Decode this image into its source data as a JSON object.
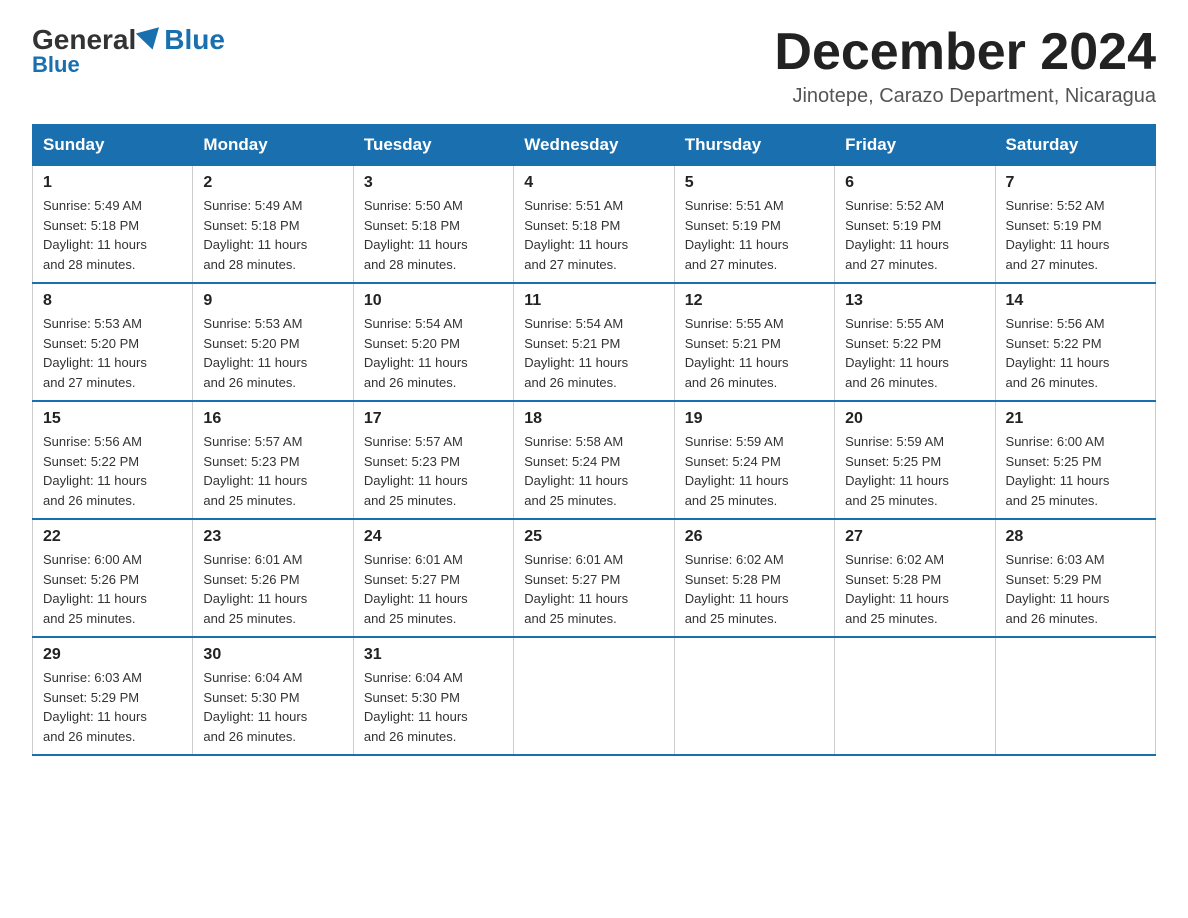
{
  "header": {
    "logo_general": "General",
    "logo_blue": "Blue",
    "month_title": "December 2024",
    "location": "Jinotepe, Carazo Department, Nicaragua"
  },
  "days_of_week": [
    "Sunday",
    "Monday",
    "Tuesday",
    "Wednesday",
    "Thursday",
    "Friday",
    "Saturday"
  ],
  "weeks": [
    [
      {
        "day": "1",
        "sunrise": "5:49 AM",
        "sunset": "5:18 PM",
        "daylight": "11 hours and 28 minutes."
      },
      {
        "day": "2",
        "sunrise": "5:49 AM",
        "sunset": "5:18 PM",
        "daylight": "11 hours and 28 minutes."
      },
      {
        "day": "3",
        "sunrise": "5:50 AM",
        "sunset": "5:18 PM",
        "daylight": "11 hours and 28 minutes."
      },
      {
        "day": "4",
        "sunrise": "5:51 AM",
        "sunset": "5:18 PM",
        "daylight": "11 hours and 27 minutes."
      },
      {
        "day": "5",
        "sunrise": "5:51 AM",
        "sunset": "5:19 PM",
        "daylight": "11 hours and 27 minutes."
      },
      {
        "day": "6",
        "sunrise": "5:52 AM",
        "sunset": "5:19 PM",
        "daylight": "11 hours and 27 minutes."
      },
      {
        "day": "7",
        "sunrise": "5:52 AM",
        "sunset": "5:19 PM",
        "daylight": "11 hours and 27 minutes."
      }
    ],
    [
      {
        "day": "8",
        "sunrise": "5:53 AM",
        "sunset": "5:20 PM",
        "daylight": "11 hours and 27 minutes."
      },
      {
        "day": "9",
        "sunrise": "5:53 AM",
        "sunset": "5:20 PM",
        "daylight": "11 hours and 26 minutes."
      },
      {
        "day": "10",
        "sunrise": "5:54 AM",
        "sunset": "5:20 PM",
        "daylight": "11 hours and 26 minutes."
      },
      {
        "day": "11",
        "sunrise": "5:54 AM",
        "sunset": "5:21 PM",
        "daylight": "11 hours and 26 minutes."
      },
      {
        "day": "12",
        "sunrise": "5:55 AM",
        "sunset": "5:21 PM",
        "daylight": "11 hours and 26 minutes."
      },
      {
        "day": "13",
        "sunrise": "5:55 AM",
        "sunset": "5:22 PM",
        "daylight": "11 hours and 26 minutes."
      },
      {
        "day": "14",
        "sunrise": "5:56 AM",
        "sunset": "5:22 PM",
        "daylight": "11 hours and 26 minutes."
      }
    ],
    [
      {
        "day": "15",
        "sunrise": "5:56 AM",
        "sunset": "5:22 PM",
        "daylight": "11 hours and 26 minutes."
      },
      {
        "day": "16",
        "sunrise": "5:57 AM",
        "sunset": "5:23 PM",
        "daylight": "11 hours and 25 minutes."
      },
      {
        "day": "17",
        "sunrise": "5:57 AM",
        "sunset": "5:23 PM",
        "daylight": "11 hours and 25 minutes."
      },
      {
        "day": "18",
        "sunrise": "5:58 AM",
        "sunset": "5:24 PM",
        "daylight": "11 hours and 25 minutes."
      },
      {
        "day": "19",
        "sunrise": "5:59 AM",
        "sunset": "5:24 PM",
        "daylight": "11 hours and 25 minutes."
      },
      {
        "day": "20",
        "sunrise": "5:59 AM",
        "sunset": "5:25 PM",
        "daylight": "11 hours and 25 minutes."
      },
      {
        "day": "21",
        "sunrise": "6:00 AM",
        "sunset": "5:25 PM",
        "daylight": "11 hours and 25 minutes."
      }
    ],
    [
      {
        "day": "22",
        "sunrise": "6:00 AM",
        "sunset": "5:26 PM",
        "daylight": "11 hours and 25 minutes."
      },
      {
        "day": "23",
        "sunrise": "6:01 AM",
        "sunset": "5:26 PM",
        "daylight": "11 hours and 25 minutes."
      },
      {
        "day": "24",
        "sunrise": "6:01 AM",
        "sunset": "5:27 PM",
        "daylight": "11 hours and 25 minutes."
      },
      {
        "day": "25",
        "sunrise": "6:01 AM",
        "sunset": "5:27 PM",
        "daylight": "11 hours and 25 minutes."
      },
      {
        "day": "26",
        "sunrise": "6:02 AM",
        "sunset": "5:28 PM",
        "daylight": "11 hours and 25 minutes."
      },
      {
        "day": "27",
        "sunrise": "6:02 AM",
        "sunset": "5:28 PM",
        "daylight": "11 hours and 25 minutes."
      },
      {
        "day": "28",
        "sunrise": "6:03 AM",
        "sunset": "5:29 PM",
        "daylight": "11 hours and 26 minutes."
      }
    ],
    [
      {
        "day": "29",
        "sunrise": "6:03 AM",
        "sunset": "5:29 PM",
        "daylight": "11 hours and 26 minutes."
      },
      {
        "day": "30",
        "sunrise": "6:04 AM",
        "sunset": "5:30 PM",
        "daylight": "11 hours and 26 minutes."
      },
      {
        "day": "31",
        "sunrise": "6:04 AM",
        "sunset": "5:30 PM",
        "daylight": "11 hours and 26 minutes."
      },
      null,
      null,
      null,
      null
    ]
  ],
  "labels": {
    "sunrise": "Sunrise:",
    "sunset": "Sunset:",
    "daylight": "Daylight:"
  }
}
